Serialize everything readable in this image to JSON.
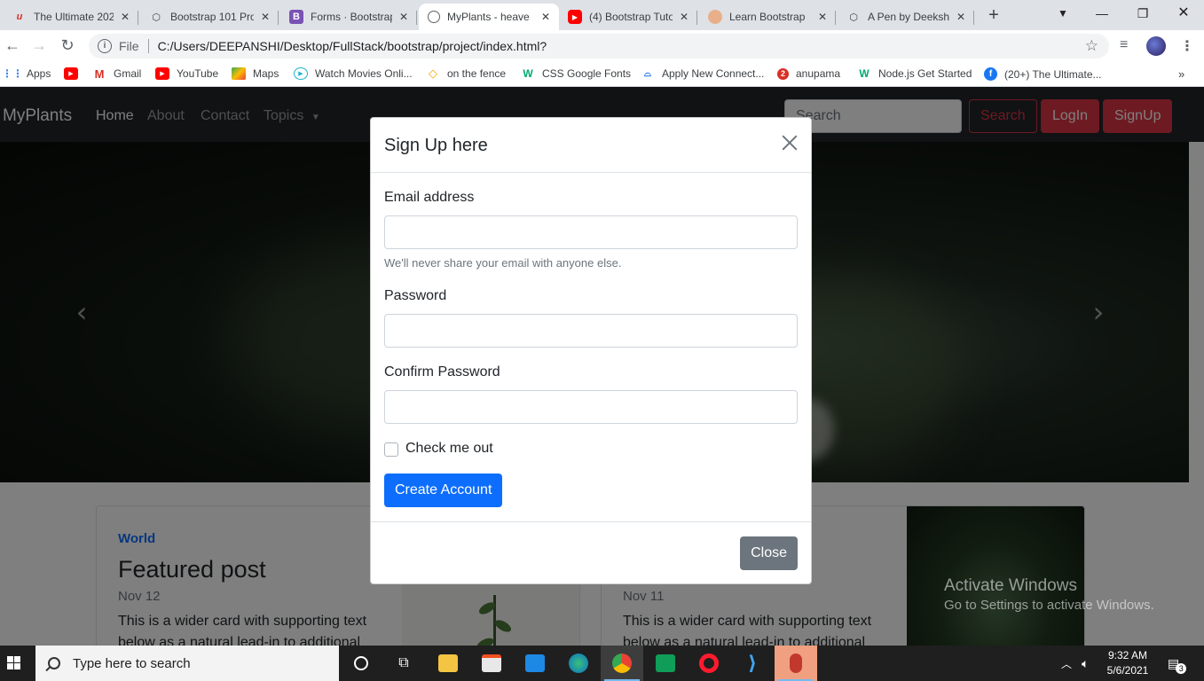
{
  "browser": {
    "tabs": [
      {
        "title": "The Ultimate 202",
        "icon": "u-logo-icon"
      },
      {
        "title": "Bootstrap 101 Pro",
        "icon": "codepen-icon"
      },
      {
        "title": "Forms · Bootstrap",
        "icon": "bootstrap-icon"
      },
      {
        "title": "MyPlants - heave",
        "icon": "globe-icon"
      },
      {
        "title": "(4) Bootstrap Tuto",
        "icon": "youtube-icon"
      },
      {
        "title": "Learn Bootstrap",
        "icon": "avatar-icon"
      },
      {
        "title": "A Pen by Deeksha",
        "icon": "codepen-icon"
      }
    ],
    "new_tab": "+",
    "address": {
      "scheme": "File",
      "url": "C:/Users/DEEPANSHI/Desktop/FullStack/bootstrap/project/index.html?"
    },
    "bookmarks": [
      {
        "label": "Apps",
        "icon": "apps-grid-icon"
      },
      {
        "label": "",
        "icon": "youtube-icon"
      },
      {
        "label": "Gmail",
        "icon": "gmail-icon"
      },
      {
        "label": "YouTube",
        "icon": "youtube-icon"
      },
      {
        "label": "Maps",
        "icon": "maps-icon"
      },
      {
        "label": "Watch Movies Onli...",
        "icon": "play-icon"
      },
      {
        "label": "on the fence",
        "icon": "diamond-icon"
      },
      {
        "label": "CSS Google Fonts",
        "icon": "w3-icon"
      },
      {
        "label": "Apply New Connect...",
        "icon": "connection-icon"
      },
      {
        "label": "anupama",
        "icon": "red-circle-icon"
      },
      {
        "label": "Node.js Get Started",
        "icon": "w3-icon"
      },
      {
        "label": "(20+) The Ultimate...",
        "icon": "facebook-icon"
      }
    ]
  },
  "site": {
    "brand": "MyPlants",
    "nav": [
      "Home",
      "About",
      "Contact",
      "Topics"
    ],
    "search_placeholder": "Search",
    "search_button": "Search",
    "login_button": "LogIn",
    "signup_button": "SignUp",
    "cards": [
      {
        "category": "World",
        "title": "Featured post",
        "date": "Nov 12",
        "text": "This is a wider card with supporting text below as a natural lead-in to additional"
      },
      {
        "category": "",
        "title": "",
        "date": "Nov 11",
        "text": "This is a wider card with supporting text below as a natural lead-in to additional"
      }
    ]
  },
  "modal": {
    "title": "Sign Up here",
    "email_label": "Email address",
    "email_help": "We'll never share your email with anyone else.",
    "password_label": "Password",
    "confirm_label": "Confirm Password",
    "check_label": "Check me out",
    "submit_label": "Create Account",
    "close_label": "Close"
  },
  "watermark": {
    "line1": "Activate Windows",
    "line2": "Go to Settings to activate Windows."
  },
  "taskbar": {
    "search_placeholder": "Type here to search",
    "time": "9:32 AM",
    "date": "5/6/2021",
    "notification_count": "3"
  },
  "colors": {
    "primary": "#0d6efd",
    "danger": "#dc3545",
    "secondary": "#6c757d",
    "navbar": "#212529"
  }
}
